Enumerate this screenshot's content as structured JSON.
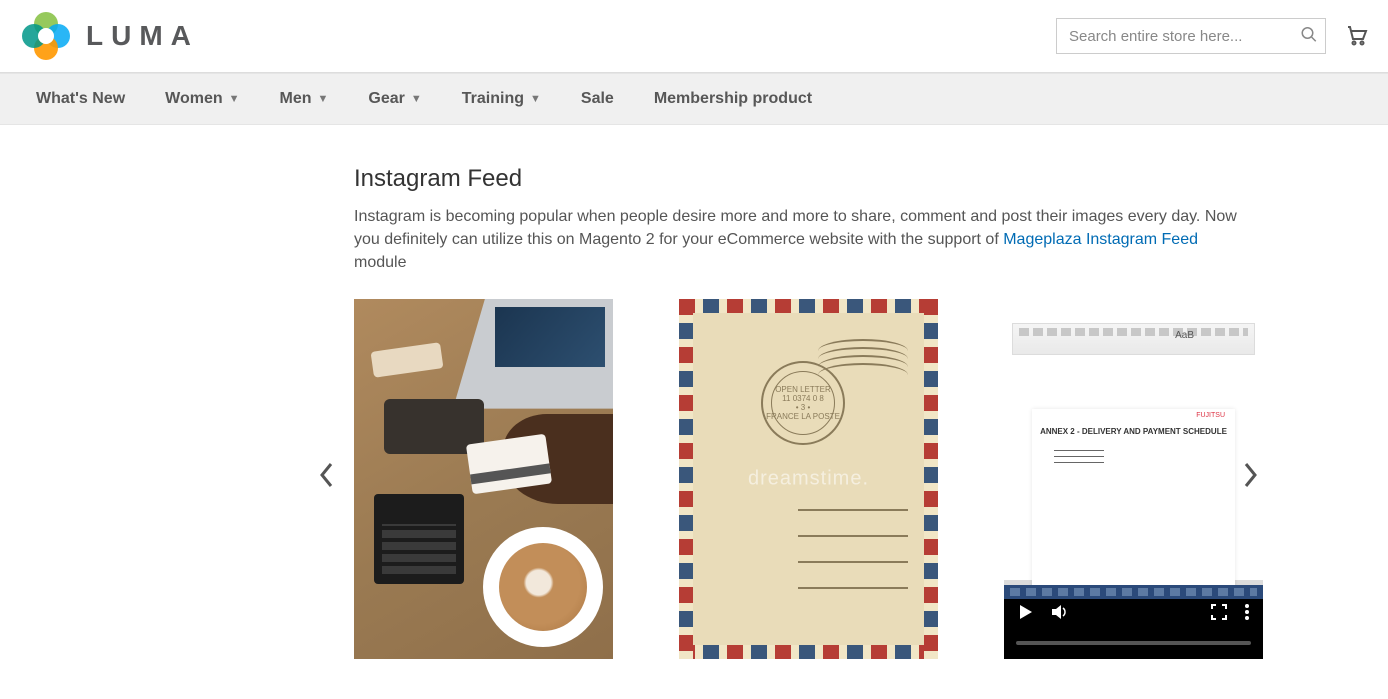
{
  "brand": {
    "name": "LUMA"
  },
  "search": {
    "placeholder": "Search entire store here..."
  },
  "nav": [
    {
      "label": "What's New",
      "dropdown": false
    },
    {
      "label": "Women",
      "dropdown": true
    },
    {
      "label": "Men",
      "dropdown": true
    },
    {
      "label": "Gear",
      "dropdown": true
    },
    {
      "label": "Training",
      "dropdown": true
    },
    {
      "label": "Sale",
      "dropdown": false
    },
    {
      "label": "Membership product",
      "dropdown": false
    }
  ],
  "section": {
    "title": "Instagram Feed",
    "desc_pre": "Instagram is becoming popular when people desire more and more to share, comment and post their images every day. Now you definitely can utilize this on Magento 2 for your eCommerce website with the support of ",
    "desc_link": "Mageplaza Instagram Feed",
    "desc_post": " module"
  },
  "feed": [
    {
      "kind": "desk-photo"
    },
    {
      "kind": "postcard",
      "stamp_top": "OPEN LETTER",
      "stamp_mid": "11 0374 0 8",
      "stamp_num": "• 3 •",
      "stamp_bot": "FRANCE LA POSTE",
      "watermark": "dreamstime."
    },
    {
      "kind": "doc-video",
      "doc_title": "ANNEX 2 - DELIVERY AND PAYMENT SCHEDULE",
      "doc_logo": "FUJITSU"
    }
  ]
}
